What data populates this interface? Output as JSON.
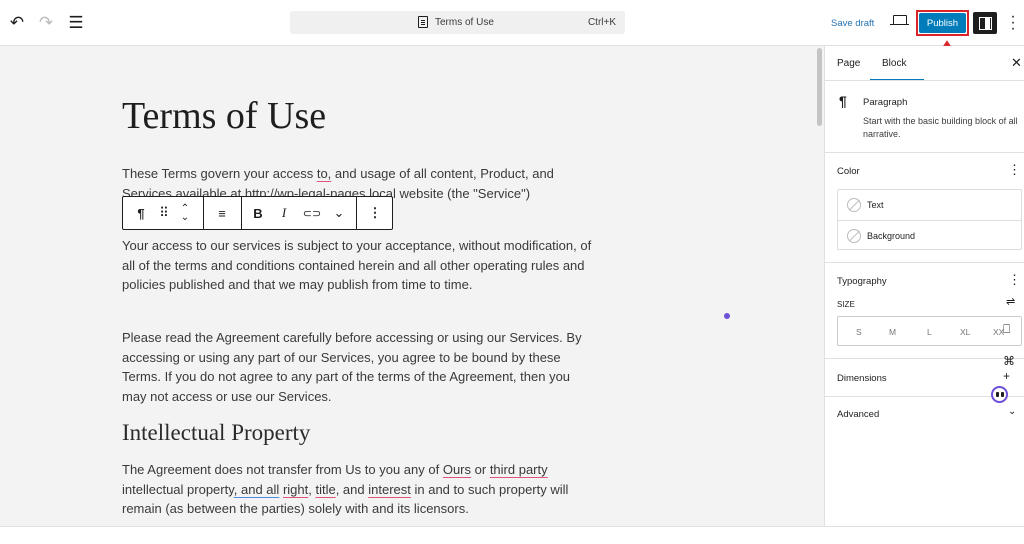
{
  "toolbar": {
    "doc_title": "Terms of Use",
    "shortcut": "Ctrl+K",
    "save_draft": "Save draft",
    "publish": "Publish"
  },
  "content": {
    "title": "Terms of Use",
    "p1a": "These Terms govern your access ",
    "p1b": "to,",
    "p1c": " and usage of all content, Product, and Services available at http://wp-legal-pages.local website (the \"Service\")",
    "p2": "Your access to our services is subject to your acceptance, without modification, of all of the terms and conditions contained herein and all other operating rules and policies published and that we may publish from time to time.",
    "p3": "Please read the Agreement carefully before accessing or using our Services. By accessing or using any part of our Services, you agree to be bound by these Terms. If you do not agree to any part of the terms of the Agreement, then you may not access or use our Services.",
    "h2": "Intellectual Property",
    "p4a": "The Agreement does not transfer from Us to you any of ",
    "p4b": "Ours",
    "p4c": " or ",
    "p4d": "third party",
    "p4e": " intellectual property",
    "p4f": ", and all",
    "p4g": " ",
    "p4h": "right",
    "p4i": ", ",
    "p4j": "title",
    "p4k": ", and ",
    "p4l": "interest",
    "p4m": " in and to such property will remain (as between the parties) solely with and its licensors."
  },
  "block_toolbar": {
    "pilcrow": "¶",
    "drag": "⠿",
    "align": "≡",
    "bold": "B",
    "italic": "I",
    "link": "🔗",
    "more_chevron": "⌄",
    "options": "⋮"
  },
  "sidebar": {
    "tabs": [
      "Page",
      "Block"
    ],
    "block_name": "Paragraph",
    "block_desc": "Start with the basic building block of all narrative.",
    "color_label": "Color",
    "color_items": [
      "Text",
      "Background"
    ],
    "typography_label": "Typography",
    "size_label": "SIZE",
    "sizes": [
      "S",
      "M",
      "L",
      "XL",
      "XX"
    ],
    "dimensions_label": "Dimensions",
    "advanced_label": "Advanced"
  },
  "colors": {
    "accent": "#007cba",
    "highlight": "#d9252a",
    "spell_underline": "#e0557a"
  },
  "icons": [
    "undo-icon",
    "redo-icon",
    "list-view-icon",
    "document-icon",
    "preview-icon",
    "settings-panel-icon",
    "more-options-icon",
    "close-icon",
    "paragraph-icon",
    "styles-icon",
    "book-icon",
    "block-icon",
    "add-icon",
    "chevron-down-icon",
    "arrow-up-annotation"
  ]
}
